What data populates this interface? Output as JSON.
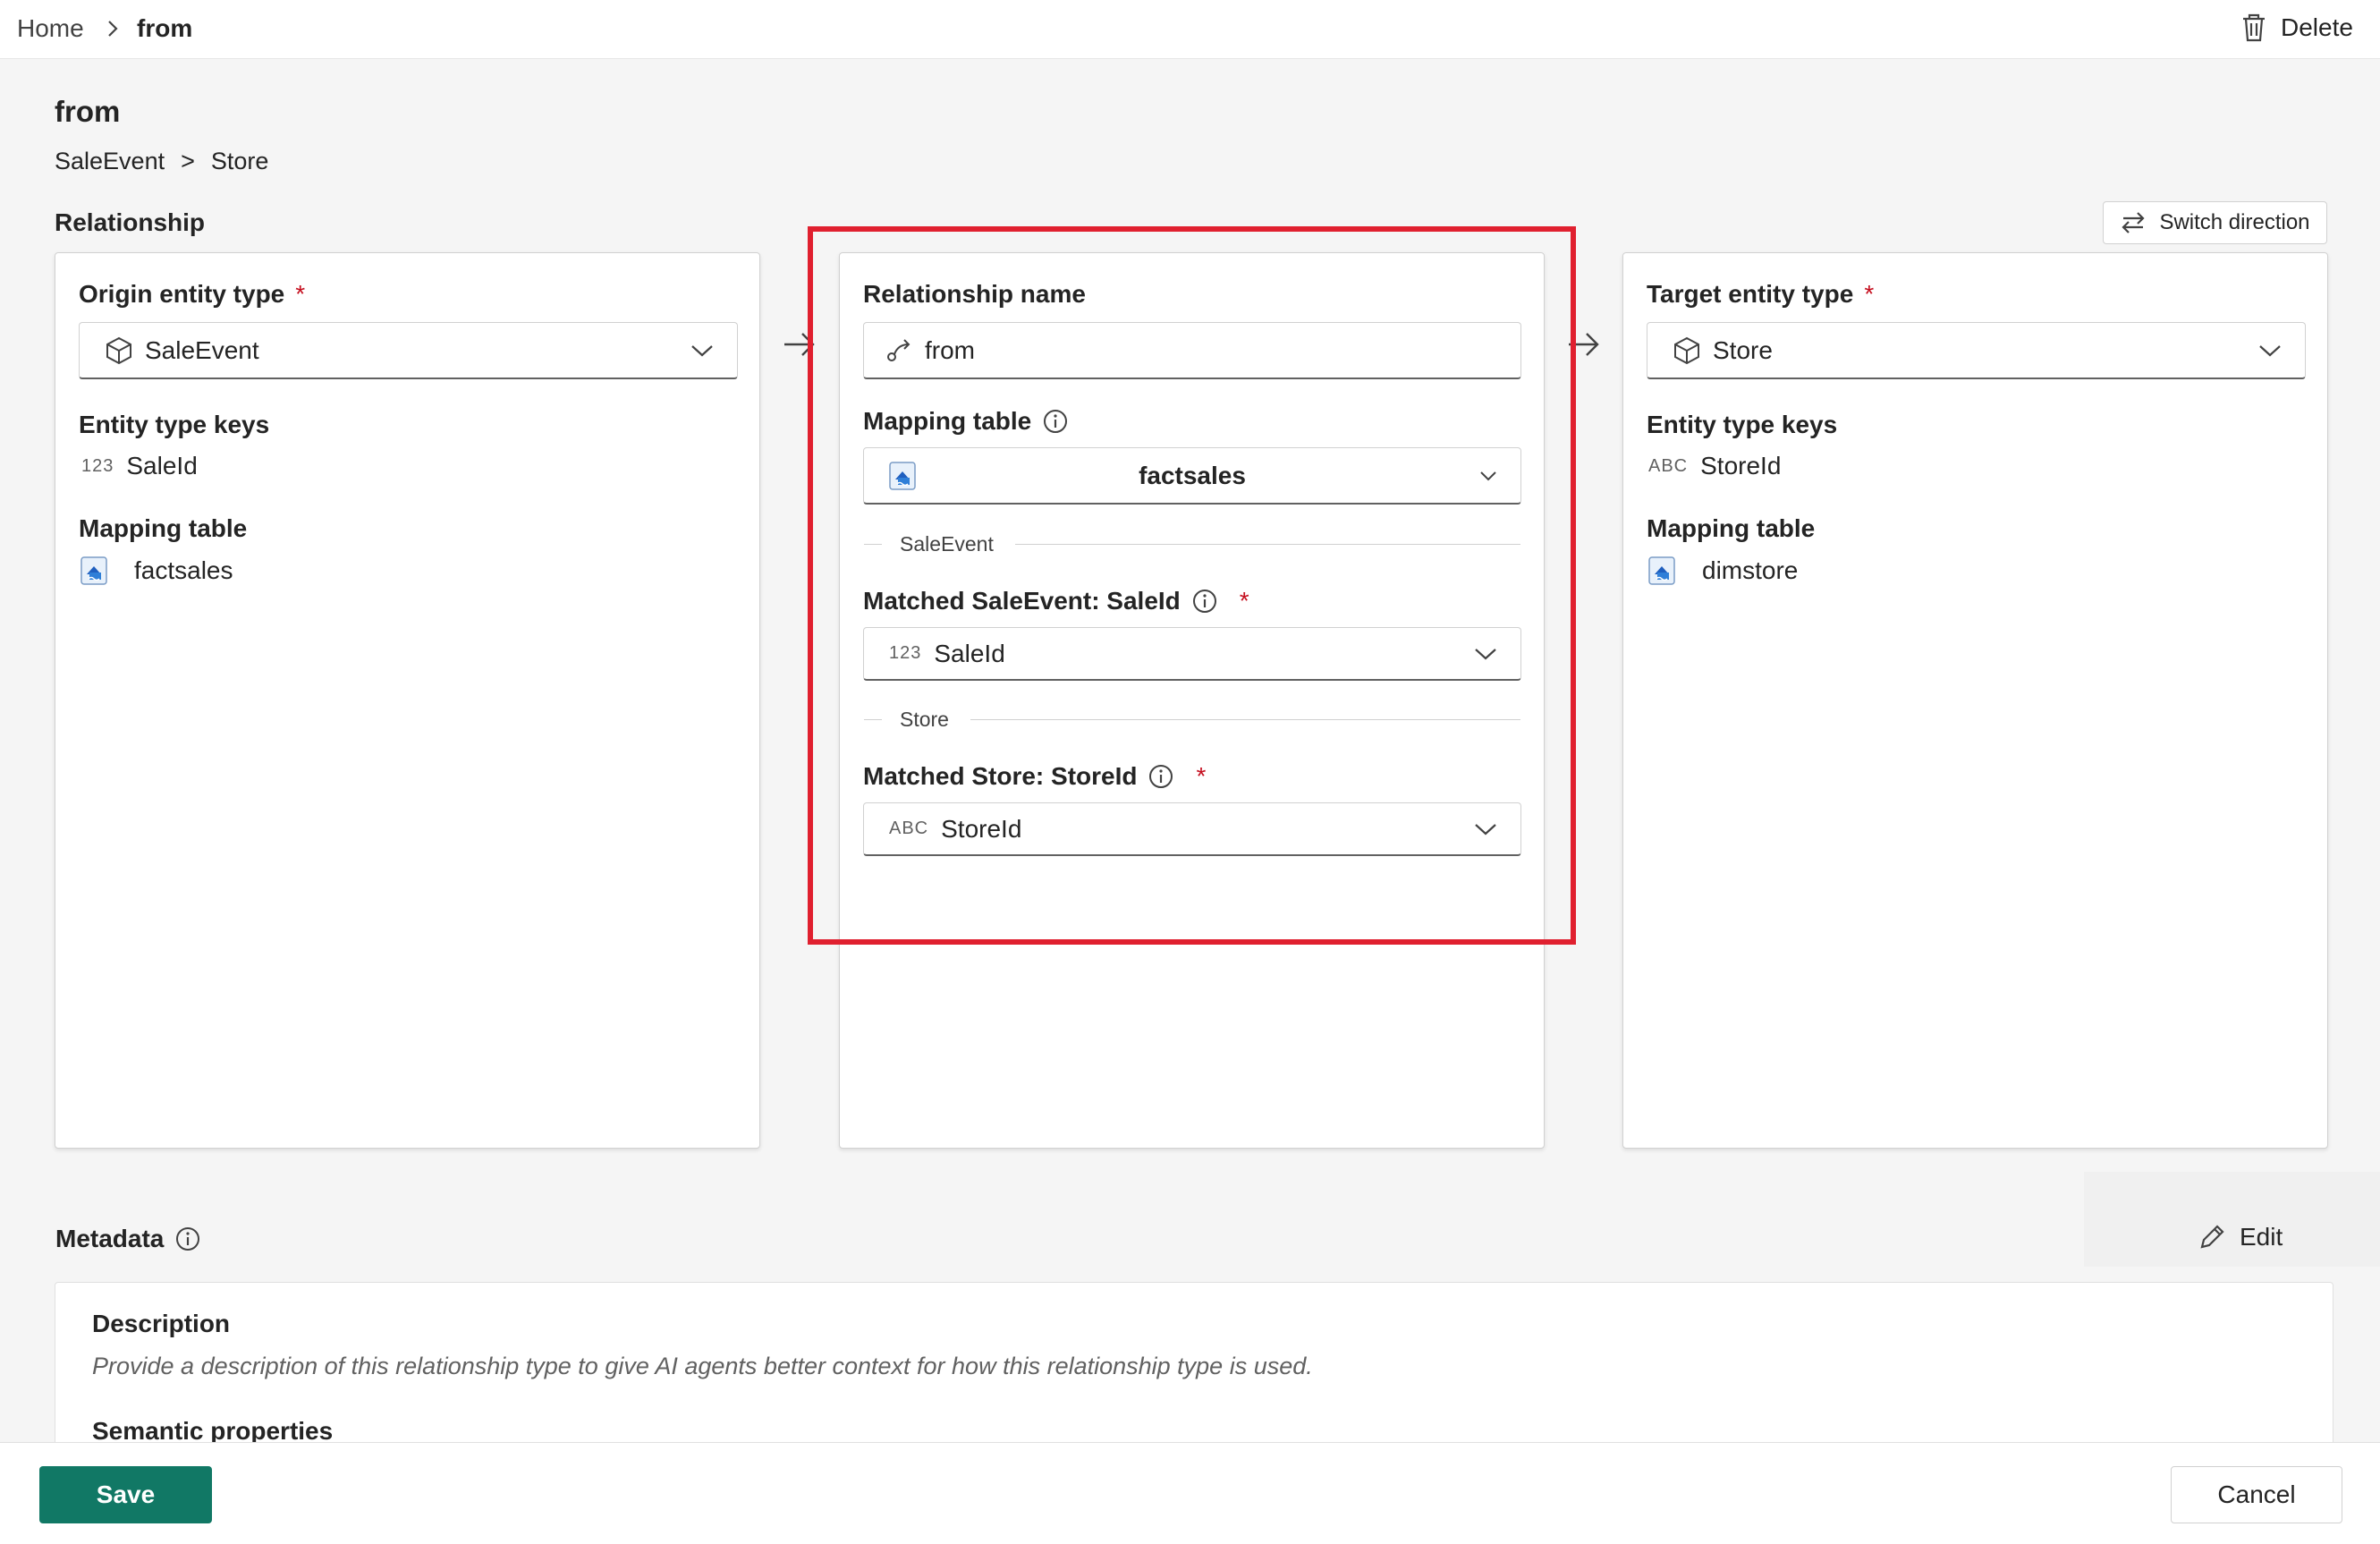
{
  "breadcrumb": {
    "home": "Home",
    "current": "from"
  },
  "toolbar": {
    "delete_label": "Delete"
  },
  "page": {
    "title": "from",
    "path": {
      "origin": "SaleEvent",
      "separator": ">",
      "target": "Store"
    },
    "section_title": "Relationship",
    "switch_direction_label": "Switch direction"
  },
  "origin": {
    "label": "Origin entity type",
    "required_mark": "*",
    "selected": "SaleEvent",
    "keys_label": "Entity type keys",
    "key_type": "123",
    "key_name": "SaleId",
    "mapping_label": "Mapping table",
    "mapping_table": "factsales"
  },
  "relationship": {
    "name_label": "Relationship name",
    "name_value": "from",
    "mapping_label": "Mapping table",
    "mapping_selected": "factsales",
    "group1": "SaleEvent",
    "matched1_label": "Matched SaleEvent: SaleId",
    "matched1_type": "123",
    "matched1_value": "SaleId",
    "group2": "Store",
    "matched2_label": "Matched Store: StoreId",
    "matched2_type": "ABC",
    "matched2_value": "StoreId",
    "required_mark": "*"
  },
  "target": {
    "label": "Target entity type",
    "required_mark": "*",
    "selected": "Store",
    "keys_label": "Entity type keys",
    "key_type": "ABC",
    "key_name": "StoreId",
    "mapping_label": "Mapping table",
    "mapping_table": "dimstore"
  },
  "metadata": {
    "title": "Metadata",
    "edit_label": "Edit",
    "description_title": "Description",
    "description_placeholder": "Provide a description of this relationship type to give AI agents better context for how this relationship type is used.",
    "semantic_title": "Semantic properties"
  },
  "footer": {
    "save_label": "Save",
    "cancel_label": "Cancel"
  },
  "colors": {
    "accent": "#117865",
    "required": "#c50f1f",
    "highlight": "#e0202f"
  }
}
